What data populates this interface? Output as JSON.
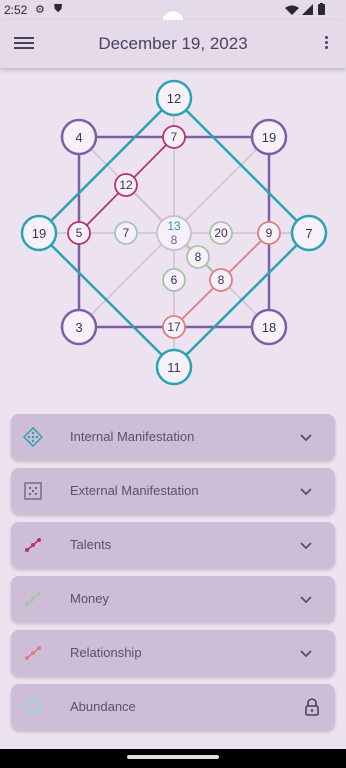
{
  "status_bar": {
    "time": "2:52"
  },
  "header": {
    "title": "December 19, 2023"
  },
  "matrix": {
    "outer_nodes": {
      "top": "12",
      "bottom": "11",
      "left": "19",
      "right": "7",
      "top_left": "4",
      "top_right": "19",
      "bottom_left": "3",
      "bottom_right": "18"
    },
    "inner_nodes": {
      "top": "7",
      "top_mid": "12",
      "left": "5",
      "left_mid": "7",
      "right": "9",
      "right_mid": "20",
      "bottom": "17",
      "center_a": "8",
      "center_b": "6",
      "center_c": "8"
    },
    "center": {
      "top": "13",
      "bottom": "8"
    }
  },
  "colors": {
    "teal": "#2aa3b2",
    "purple": "#7c5fa6",
    "magenta": "#b8336a",
    "salmon": "#e07c84",
    "sage": "#a8c4a5",
    "card_bg": "#cdbdd6"
  },
  "cards": [
    {
      "label": "Internal Manifestation",
      "icon": "diamond-dots-icon",
      "action": "chevron-down-icon"
    },
    {
      "label": "External Manifestation",
      "icon": "square-dots-icon",
      "action": "chevron-down-icon"
    },
    {
      "label": "Talents",
      "icon": "talents-line-icon",
      "action": "chevron-down-icon"
    },
    {
      "label": "Money",
      "icon": "money-line-icon",
      "action": "chevron-down-icon"
    },
    {
      "label": "Relationship",
      "icon": "relationship-line-icon",
      "action": "chevron-down-icon"
    },
    {
      "label": "Abundance",
      "icon": "ring-icon",
      "action": "lock-icon"
    }
  ]
}
